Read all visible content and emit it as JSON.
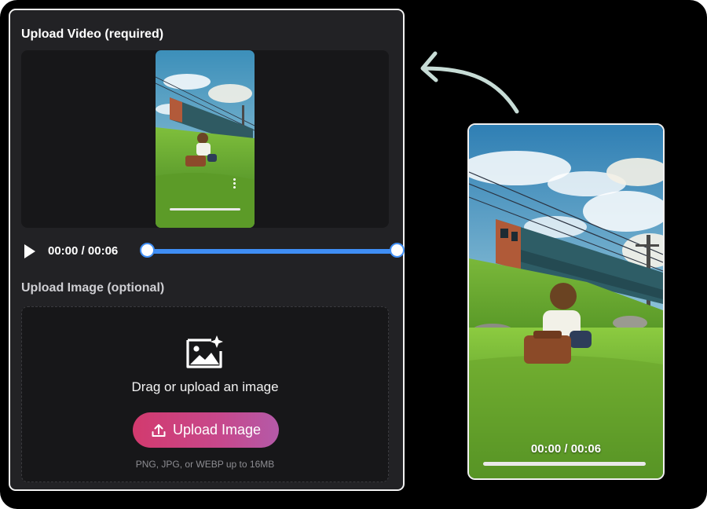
{
  "upload_video": {
    "label": "Upload Video (required)",
    "player": {
      "current": "00:00",
      "separator": " / ",
      "duration": "00:06",
      "trim_start": 0.0,
      "trim_end": 1.0
    }
  },
  "upload_image": {
    "label": "Upload Image (optional)",
    "prompt": "Drag or upload an image",
    "button_label": "Upload Image",
    "hint": "PNG, JPG, or WEBP up to 16MB"
  },
  "preview": {
    "current": "00:00",
    "separator": " / ",
    "duration": "00:06"
  },
  "colors": {
    "accent_blue": "#3f8ef5",
    "button_pink": "#d23a6e",
    "button_purple": "#b45aa8",
    "arrow": "#c7dcd6"
  },
  "icons": [
    "play-icon",
    "image-sparkle-icon",
    "upload-icon",
    "more-vertical-icon",
    "curved-arrow-icon"
  ]
}
